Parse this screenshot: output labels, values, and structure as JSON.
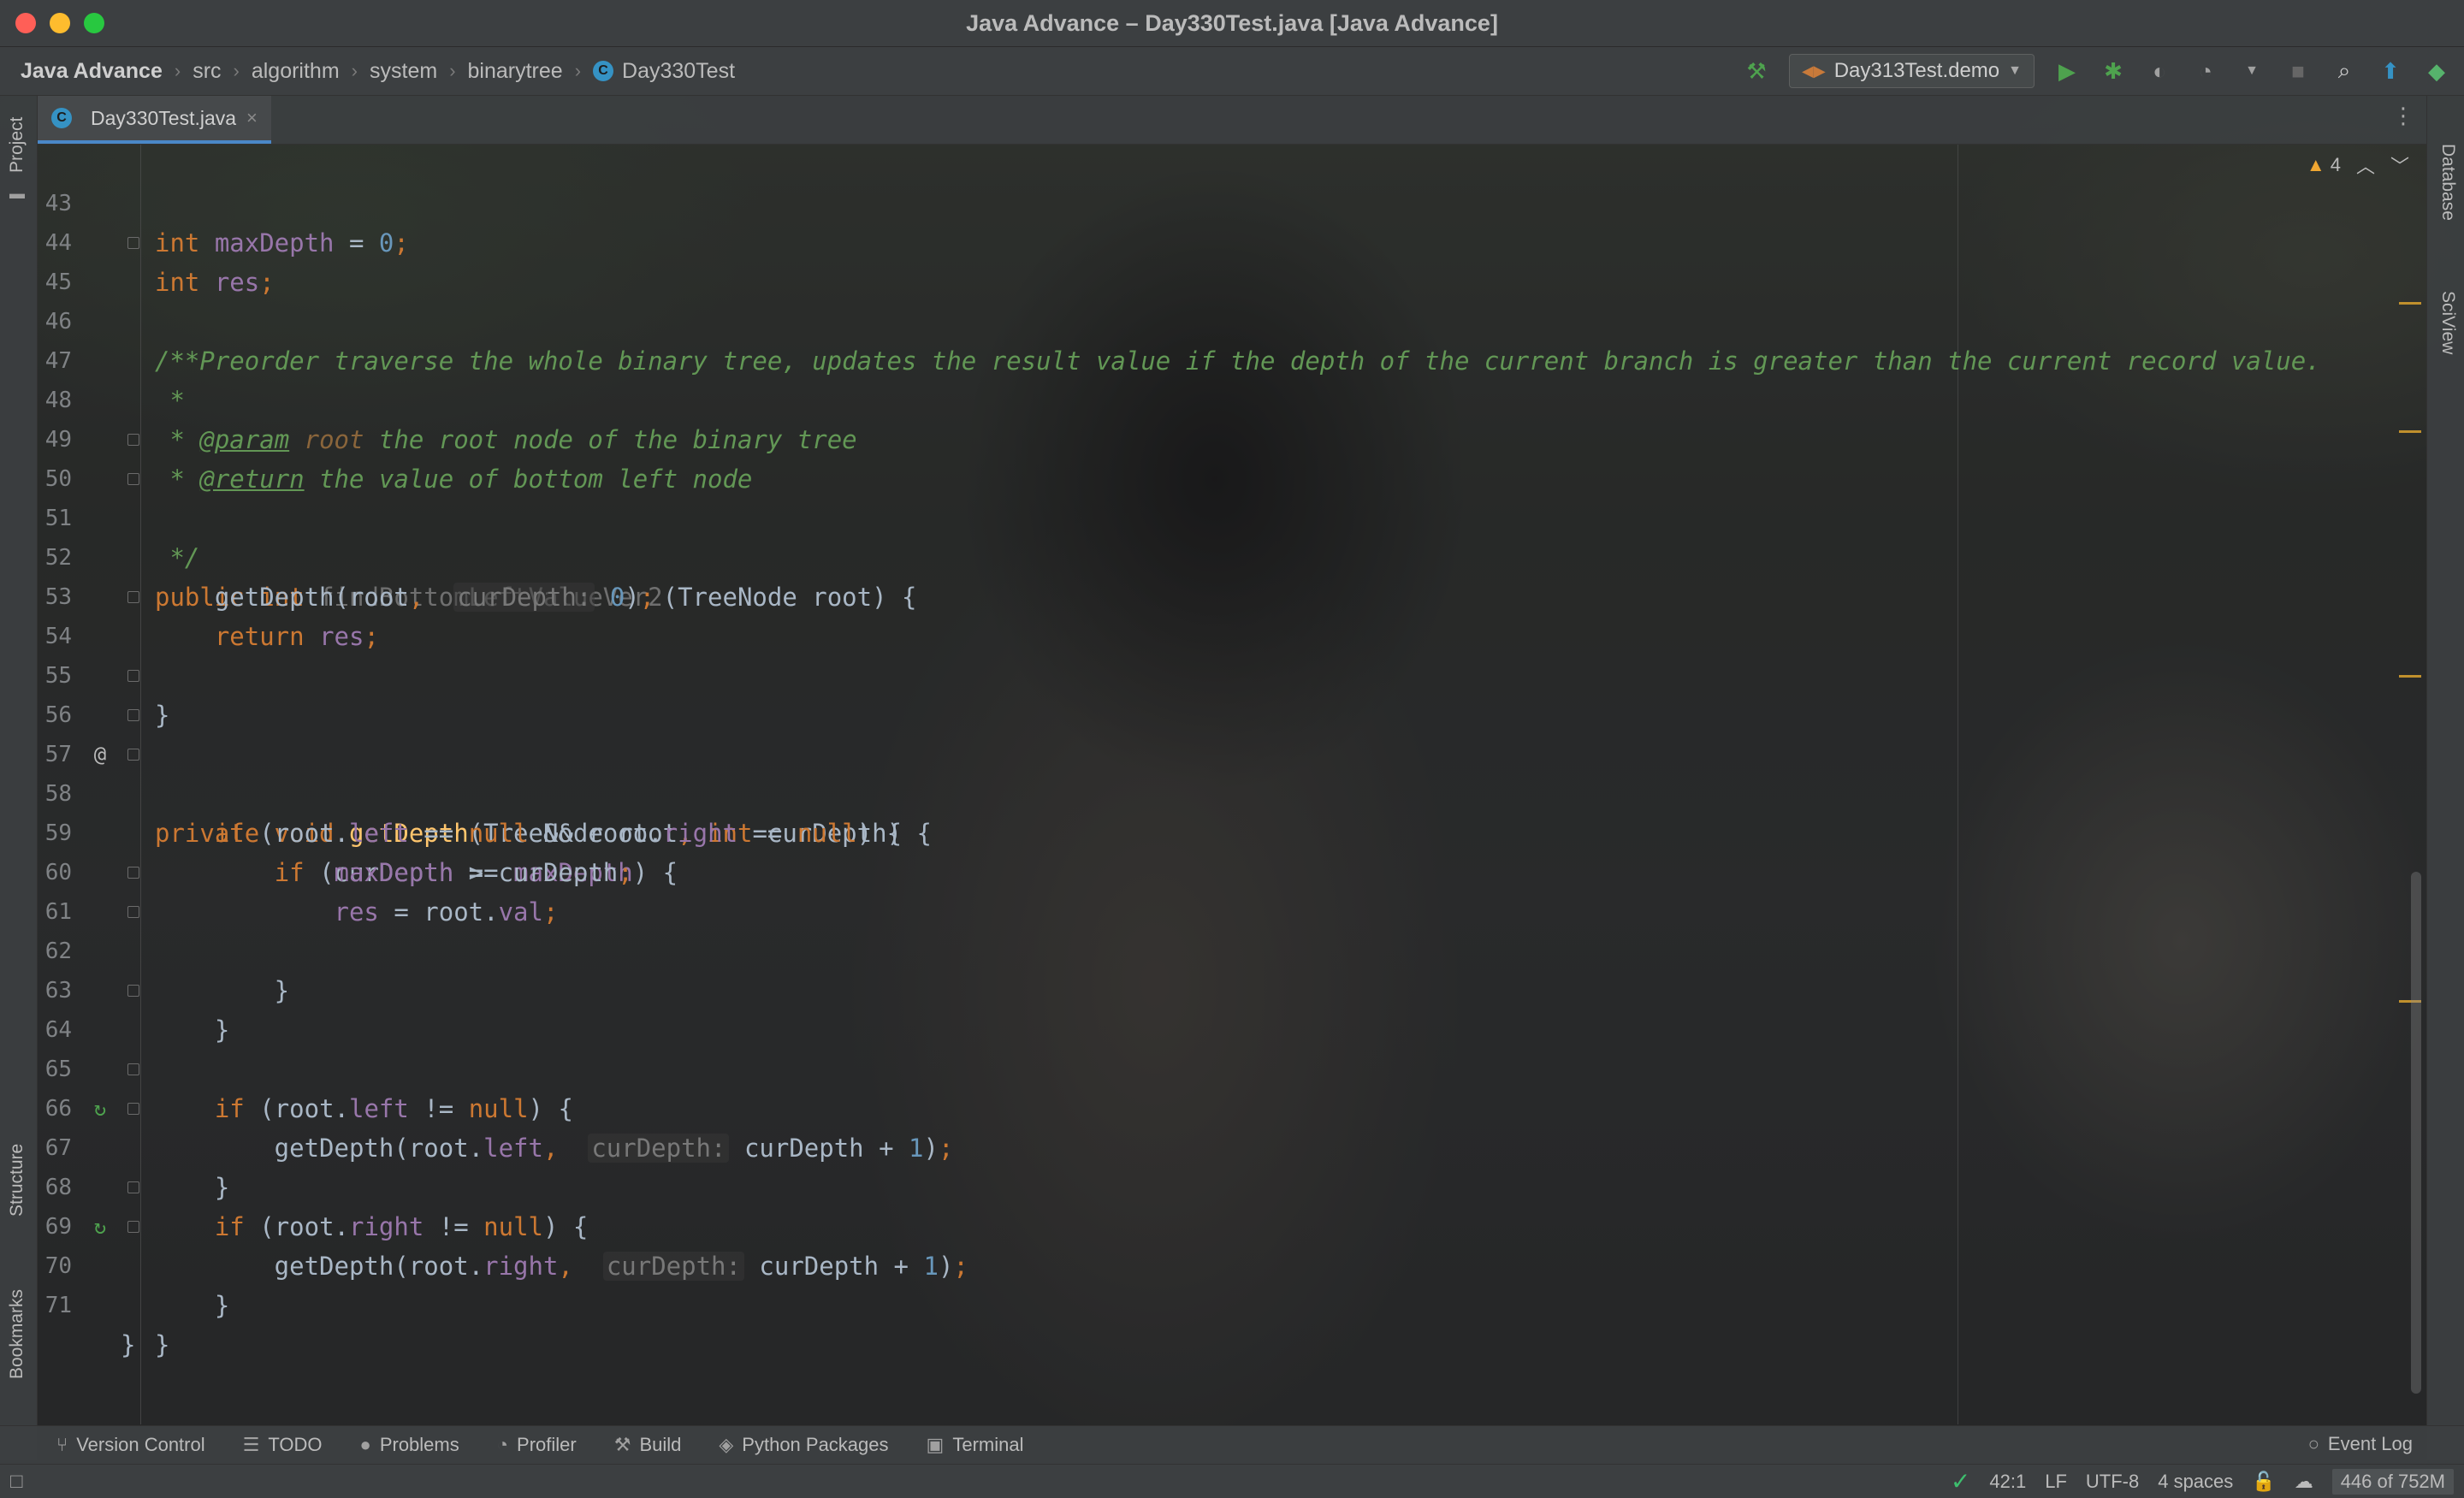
{
  "window": {
    "title": "Java Advance – Day330Test.java [Java Advance]"
  },
  "breadcrumbs": [
    "Java Advance",
    "src",
    "algorithm",
    "system",
    "binarytree",
    "Day330Test"
  ],
  "class_badge": "C",
  "toolbar": {
    "run_config": "Day313Test.demo"
  },
  "tabs": [
    {
      "label": "Day330Test.java",
      "close": "×"
    }
  ],
  "left_strip": {
    "project": "Project",
    "structure": "Structure",
    "bookmarks": "Bookmarks"
  },
  "right_strip": {
    "database": "Database",
    "sciview": "SciView"
  },
  "inspections": {
    "warnings": "4"
  },
  "editor": {
    "lines": [
      {
        "n": "43",
        "text": "int maxDepth = 0;"
      },
      {
        "n": "44",
        "text": "int res;"
      },
      {
        "n": "45",
        "text": "/**"
      },
      {
        "n": "46",
        "text": " * Preorder traverse the whole binary tree, updates the result value if the depth of the current branch is greater than the current record value."
      },
      {
        "n": "47",
        "text": " *"
      },
      {
        "n": "48",
        "text": " * @param root the root node of the binary tree"
      },
      {
        "n": "49",
        "text": " * @return the value of bottom left node"
      },
      {
        "n": "50",
        "text": " */"
      },
      {
        "n": "51",
        "text": "public int findBottomLeftValueVer2(TreeNode root) {"
      },
      {
        "n": "52",
        "text": "getDepth(root, curDepth: 0);"
      },
      {
        "n": "53",
        "text": "return res;"
      },
      {
        "n": "54",
        "text": "}"
      },
      {
        "n": "55",
        "text": ""
      },
      {
        "n": "56",
        "text": "private void getDepth(TreeNode root, int curDepth) {"
      },
      {
        "n": "57",
        "text": "if (root.left == null && root.right == null) {"
      },
      {
        "n": "58",
        "text": "if (curDepth >= maxDepth) {"
      },
      {
        "n": "59",
        "text": "maxDepth = curDepth;"
      },
      {
        "n": "60",
        "text": "res = root.val;"
      },
      {
        "n": "61",
        "text": "}"
      },
      {
        "n": "62",
        "text": "}"
      },
      {
        "n": "63",
        "text": ""
      },
      {
        "n": "64",
        "text": "if (root.left != null) {"
      },
      {
        "n": "65",
        "text": "getDepth(root.left, curDepth: curDepth + 1);"
      },
      {
        "n": "66",
        "text": "}"
      },
      {
        "n": "67",
        "text": "if (root.right != null) {"
      },
      {
        "n": "68",
        "text": "getDepth(root.right, curDepth: curDepth + 1);"
      },
      {
        "n": "69",
        "text": "}"
      },
      {
        "n": "70",
        "text": "}"
      },
      {
        "n": "71",
        "text": "}"
      }
    ]
  },
  "tool_windows": [
    "Version Control",
    "TODO",
    "Problems",
    "Profiler",
    "Build",
    "Python Packages",
    "Terminal"
  ],
  "event_log": "Event Log",
  "status": {
    "position": "42:1",
    "line_sep": "LF",
    "encoding": "UTF-8",
    "indent": "4 spaces",
    "memory": "446 of 752M"
  },
  "colors": {
    "keyword": "#cc7832",
    "field": "#9876aa",
    "number": "#6897bb",
    "comment": "#629755",
    "method_decl": "#ffc66d",
    "accent": "#4a88c7"
  }
}
